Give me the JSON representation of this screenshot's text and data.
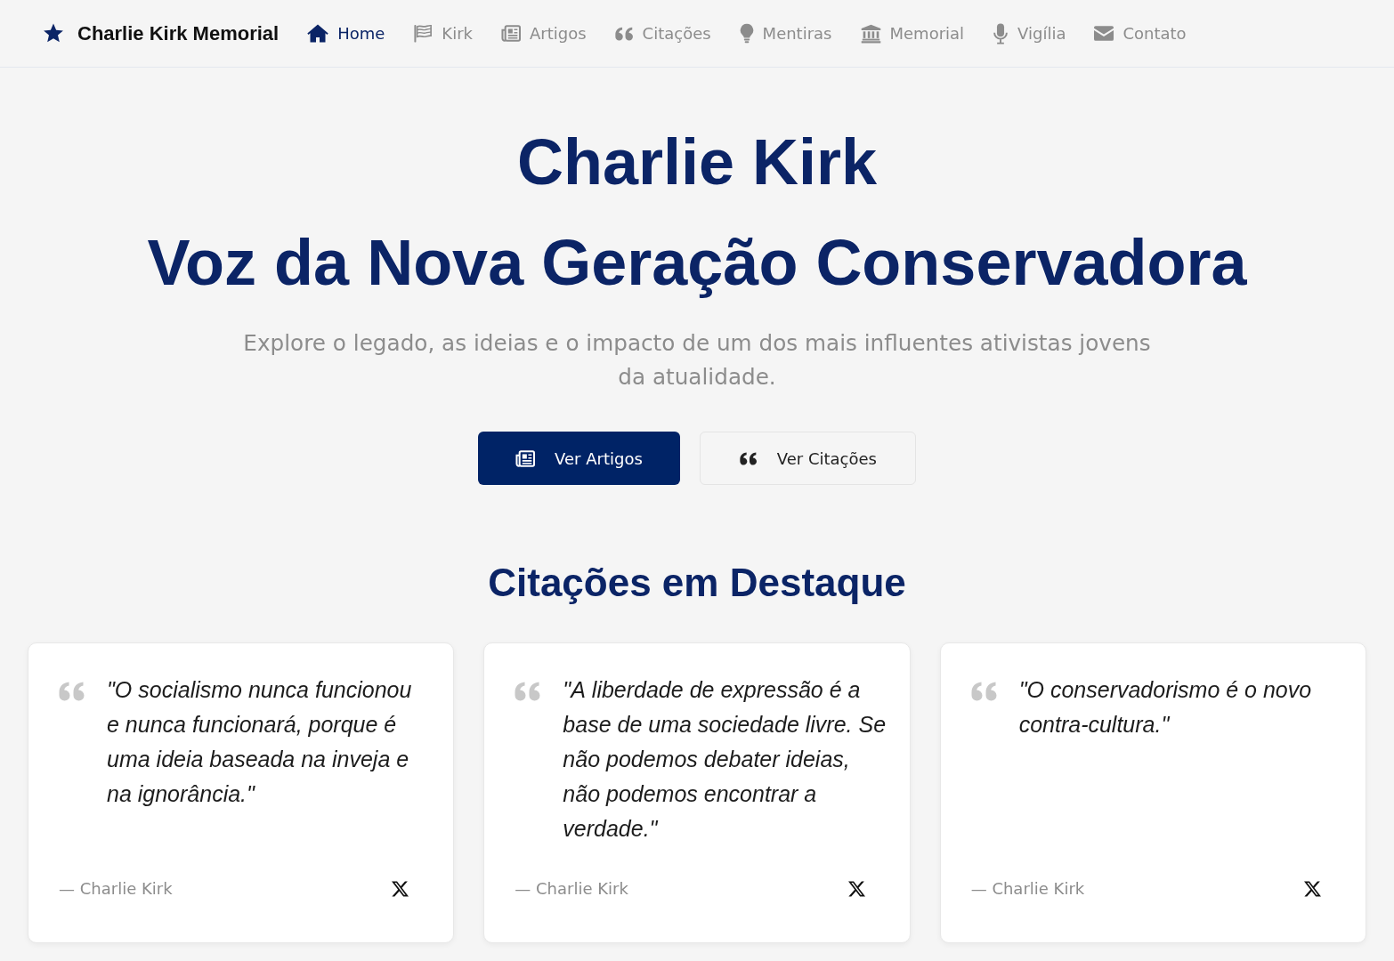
{
  "navbar": {
    "brand": "Charlie Kirk Memorial",
    "items": [
      {
        "label": "Home",
        "selected": true
      },
      {
        "label": "Kirk",
        "selected": false
      },
      {
        "label": "Artigos",
        "selected": false
      },
      {
        "label": "Citações",
        "selected": false
      },
      {
        "label": "Mentiras",
        "selected": false
      },
      {
        "label": "Memorial",
        "selected": false
      },
      {
        "label": "Vigília",
        "selected": false
      },
      {
        "label": "Contato",
        "selected": false
      }
    ]
  },
  "hero": {
    "title": "Charlie Kirk",
    "tagline": "Voz da Nova Geração Conservadora",
    "description": "Explore o legado, as ideias e o impacto de um dos mais influentes ativistas jovens da atualidade.",
    "buttons": [
      {
        "label": "Ver Artigos",
        "kind": "primary"
      },
      {
        "label": "Ver Citações",
        "kind": "secondary"
      }
    ]
  },
  "featured_quotes": {
    "title": "Citações em Destaque",
    "quotes": [
      {
        "text": "\"O socialismo nunca funcionou e nunca funcionará, porque é uma ideia baseada na inveja e na ignorância.\"",
        "author": "— Charlie Kirk"
      },
      {
        "text": "\"A liberdade de expressão é a base de uma sociedade livre. Se não podemos debater ideias, não podemos encontrar a verdade.\"",
        "author": "— Charlie Kirk"
      },
      {
        "text": "\"O conservadorismo é o novo contra-cultura.\"",
        "author": "— Charlie Kirk"
      }
    ]
  }
}
